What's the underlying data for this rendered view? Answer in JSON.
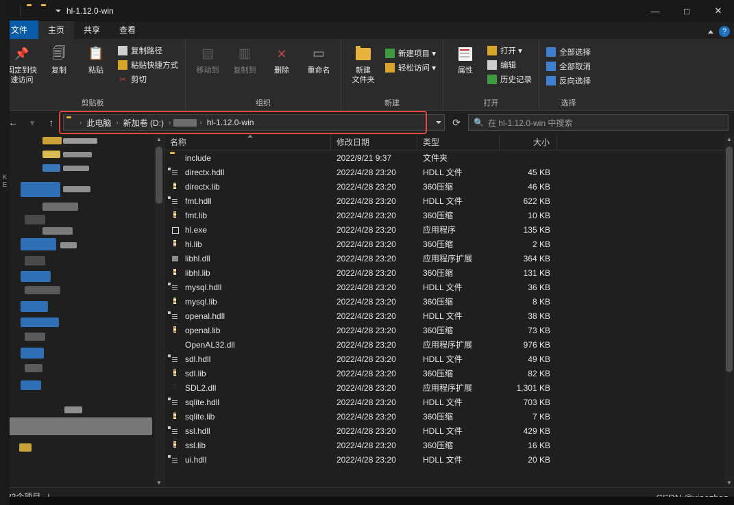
{
  "window": {
    "title": "hl-1.12.0-win",
    "minimize": "—",
    "maximize": "□",
    "close": "✕"
  },
  "ribbon_tabs": [
    {
      "label": "文件",
      "kind": "file"
    },
    {
      "label": "主页",
      "kind": "active"
    },
    {
      "label": "共享",
      "kind": "normal"
    },
    {
      "label": "查看",
      "kind": "normal"
    }
  ],
  "ribbon": {
    "help_glyph": "?",
    "collapse_glyph": "^",
    "groups": [
      {
        "label": "剪贴板",
        "big": [
          {
            "label": "固定到快\n速访问",
            "icon": "pin-icon"
          },
          {
            "label": "复制",
            "icon": "copy-icon"
          },
          {
            "label": "粘贴",
            "icon": "paste-icon"
          }
        ],
        "small": [
          {
            "label": "复制路径",
            "icon": "copy-path-icon"
          },
          {
            "label": "粘贴快捷方式",
            "icon": "paste-shortcut-icon"
          },
          {
            "label": "剪切",
            "icon": "scissors-icon"
          }
        ]
      },
      {
        "label": "组织",
        "big": [
          {
            "label": "移动到",
            "icon": "move-to-icon"
          },
          {
            "label": "复制到",
            "icon": "copy-to-icon"
          },
          {
            "label": "删除",
            "icon": "delete-icon"
          },
          {
            "label": "重命名",
            "icon": "rename-icon"
          }
        ],
        "small": []
      },
      {
        "label": "新建",
        "big": [
          {
            "label": "新建\n文件夹",
            "icon": "new-folder-icon"
          }
        ],
        "small": [
          {
            "label": "新建项目 ▾",
            "icon": "new-item-icon"
          },
          {
            "label": "轻松访问 ▾",
            "icon": "easy-access-icon"
          }
        ]
      },
      {
        "label": "打开",
        "big": [
          {
            "label": "属性",
            "icon": "properties-icon"
          }
        ],
        "small": [
          {
            "label": "打开 ▾",
            "icon": "open-icon"
          },
          {
            "label": "编辑",
            "icon": "edit-icon"
          },
          {
            "label": "历史记录",
            "icon": "history-icon"
          }
        ]
      },
      {
        "label": "选择",
        "big": [],
        "small": [
          {
            "label": "全部选择",
            "icon": "select-all-icon"
          },
          {
            "label": "全部取消",
            "icon": "select-none-icon"
          },
          {
            "label": "反向选择",
            "icon": "invert-selection-icon"
          }
        ]
      }
    ]
  },
  "nav": {
    "back": "←",
    "forward": "→",
    "recent": "▾",
    "up": "↑",
    "breadcrumb": [
      {
        "text": "此电脑",
        "type": "text"
      },
      {
        "text": "新加卷 (D:)",
        "type": "text"
      },
      {
        "text": "",
        "type": "redacted"
      },
      {
        "text": "hl-1.12.0-win",
        "type": "text"
      }
    ],
    "dropdown_glyph": "▾",
    "refresh_glyph": "⟳",
    "search_placeholder": "在 hl-1.12.0-win 中搜索",
    "search_icon": "search-icon"
  },
  "columns": [
    {
      "key": "name",
      "label": "名称"
    },
    {
      "key": "date",
      "label": "修改日期"
    },
    {
      "key": "type",
      "label": "类型"
    },
    {
      "key": "size",
      "label": "大小"
    }
  ],
  "files": [
    {
      "name": "include",
      "date": "2022/9/21 9:37",
      "type": "文件夹",
      "size": "",
      "icon": "folder-icon"
    },
    {
      "name": "directx.hdll",
      "date": "2022/4/28 23:20",
      "type": "HDLL 文件",
      "size": "45 KB",
      "icon": "document-icon"
    },
    {
      "name": "directx.lib",
      "date": "2022/4/28 23:20",
      "type": "360压缩",
      "size": "46 KB",
      "icon": "archive-icon"
    },
    {
      "name": "fmt.hdll",
      "date": "2022/4/28 23:20",
      "type": "HDLL 文件",
      "size": "622 KB",
      "icon": "document-icon"
    },
    {
      "name": "fmt.lib",
      "date": "2022/4/28 23:20",
      "type": "360压缩",
      "size": "10 KB",
      "icon": "archive-icon"
    },
    {
      "name": "hl.exe",
      "date": "2022/4/28 23:20",
      "type": "应用程序",
      "size": "135 KB",
      "icon": "exe-icon"
    },
    {
      "name": "hl.lib",
      "date": "2022/4/28 23:20",
      "type": "360压缩",
      "size": "2 KB",
      "icon": "archive-icon"
    },
    {
      "name": "libhl.dll",
      "date": "2022/4/28 23:20",
      "type": "应用程序扩展",
      "size": "364 KB",
      "icon": "dll-icon"
    },
    {
      "name": "libhl.lib",
      "date": "2022/4/28 23:20",
      "type": "360压缩",
      "size": "131 KB",
      "icon": "archive-icon"
    },
    {
      "name": "mysql.hdll",
      "date": "2022/4/28 23:20",
      "type": "HDLL 文件",
      "size": "36 KB",
      "icon": "document-icon"
    },
    {
      "name": "mysql.lib",
      "date": "2022/4/28 23:20",
      "type": "360压缩",
      "size": "8 KB",
      "icon": "archive-icon"
    },
    {
      "name": "openal.hdll",
      "date": "2022/4/28 23:20",
      "type": "HDLL 文件",
      "size": "38 KB",
      "icon": "document-icon"
    },
    {
      "name": "openal.lib",
      "date": "2022/4/28 23:20",
      "type": "360压缩",
      "size": "73 KB",
      "icon": "archive-icon"
    },
    {
      "name": "OpenAL32.dll",
      "date": "2022/4/28 23:20",
      "type": "应用程序扩展",
      "size": "976 KB",
      "icon": "openal-icon"
    },
    {
      "name": "sdl.hdll",
      "date": "2022/4/28 23:20",
      "type": "HDLL 文件",
      "size": "49 KB",
      "icon": "document-icon"
    },
    {
      "name": "sdl.lib",
      "date": "2022/4/28 23:20",
      "type": "360压缩",
      "size": "82 KB",
      "icon": "archive-icon"
    },
    {
      "name": "SDL2.dll",
      "date": "2022/4/28 23:20",
      "type": "应用程序扩展",
      "size": "1,301 KB",
      "icon": "sdl-icon"
    },
    {
      "name": "sqlite.hdll",
      "date": "2022/4/28 23:20",
      "type": "HDLL 文件",
      "size": "703 KB",
      "icon": "document-icon"
    },
    {
      "name": "sqlite.lib",
      "date": "2022/4/28 23:20",
      "type": "360压缩",
      "size": "7 KB",
      "icon": "archive-icon"
    },
    {
      "name": "ssl.hdll",
      "date": "2022/4/28 23:20",
      "type": "HDLL 文件",
      "size": "429 KB",
      "icon": "document-icon"
    },
    {
      "name": "ssl.lib",
      "date": "2022/4/28 23:20",
      "type": "360压缩",
      "size": "16 KB",
      "icon": "archive-icon"
    },
    {
      "name": "ui.hdll",
      "date": "2022/4/28 23:20",
      "type": "HDLL 文件",
      "size": "20 KB",
      "icon": "document-icon"
    }
  ],
  "status": {
    "count_text": "个项目",
    "separator": "|"
  },
  "watermark": "CSDN @xiaozhan",
  "colors": {
    "accent": "#0a5ca8",
    "highlight": "#e8473f",
    "folder": "#e8b33c",
    "window_bg": "#1f1f1f",
    "ribbon_bg": "#2b2b2b"
  }
}
